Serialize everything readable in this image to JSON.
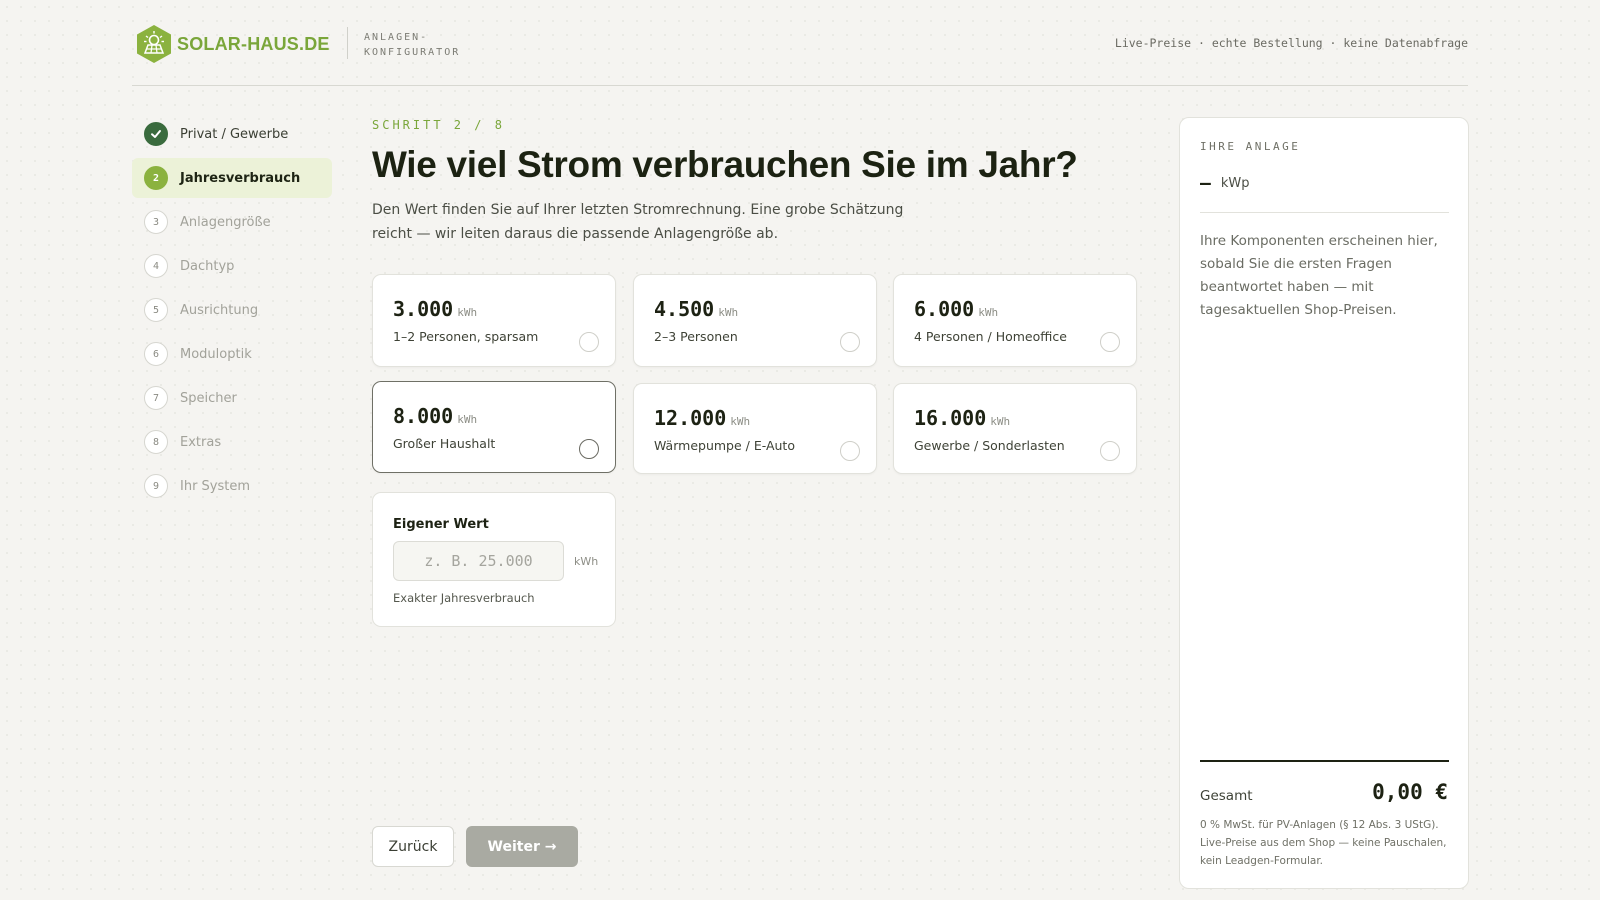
{
  "header": {
    "brand": "SOLAR-HAUS.DE",
    "app_name": "ANLAGEN-KONFIGURATOR",
    "tagline": "Live-Preise · echte Bestellung · keine Datenabfrage",
    "brand_color": "#7aa63a"
  },
  "steps": [
    {
      "number": "✓",
      "label": "Privat / Gewerbe",
      "state": "done"
    },
    {
      "number": "2",
      "label": "Jahresverbrauch",
      "state": "active"
    },
    {
      "number": "3",
      "label": "Anlagengröße",
      "state": "pending"
    },
    {
      "number": "4",
      "label": "Dachtyp",
      "state": "pending"
    },
    {
      "number": "5",
      "label": "Ausrichtung",
      "state": "pending"
    },
    {
      "number": "6",
      "label": "Moduloptik",
      "state": "pending"
    },
    {
      "number": "7",
      "label": "Speicher",
      "state": "pending"
    },
    {
      "number": "8",
      "label": "Extras",
      "state": "pending"
    },
    {
      "number": "9",
      "label": "Ihr System",
      "state": "pending"
    }
  ],
  "main": {
    "eyebrow": "SCHRITT 2 / 8",
    "title": "Wie viel Strom verbrauchen Sie im Jahr?",
    "intro": "Den Wert finden Sie auf Ihrer letzten Stromrechnung. Eine grobe Schätzung reicht — wir leiten daraus die passende Anlagengröße ab.",
    "options": [
      {
        "value": "3.000",
        "unit": "kWh",
        "desc": "1–2 Personen, sparsam",
        "selected": false
      },
      {
        "value": "4.500",
        "unit": "kWh",
        "desc": "2–3 Personen",
        "selected": false
      },
      {
        "value": "6.000",
        "unit": "kWh",
        "desc": "4 Personen / Homeoffice",
        "selected": false
      },
      {
        "value": "8.000",
        "unit": "kWh",
        "desc": "Großer Haushalt",
        "selected": true
      },
      {
        "value": "12.000",
        "unit": "kWh",
        "desc": "Wärmepumpe / E-Auto",
        "selected": false
      },
      {
        "value": "16.000",
        "unit": "kWh",
        "desc": "Gewerbe / Sonderlasten",
        "selected": false
      }
    ],
    "custom": {
      "label": "Eigener Wert",
      "placeholder": "z. B. 25.000",
      "value": "",
      "unit": "kWh",
      "hint": "Exakter Jahresverbrauch"
    },
    "back_label": "Zurück",
    "next_label": "Weiter →"
  },
  "summary": {
    "eyebrow": "IHRE ANLAGE",
    "kwp_value": "–",
    "kwp_unit": "kWp",
    "empty_text": "Ihre Komponenten erscheinen hier, sobald Sie die ersten Fragen beantwortet haben — mit tagesaktuellen Shop-Preisen.",
    "total_label": "Gesamt",
    "total_value": "0,00 €",
    "note": "0 % MwSt. für PV-Anlagen (§ 12 Abs. 3 UStG). Live-Preise aus dem Shop — keine Pauschalen, kein Leadgen-Formular."
  },
  "icons": {
    "logo": "sun-house-hexagon-icon",
    "done_step": "check-icon",
    "option_radio": "radio-icon"
  }
}
